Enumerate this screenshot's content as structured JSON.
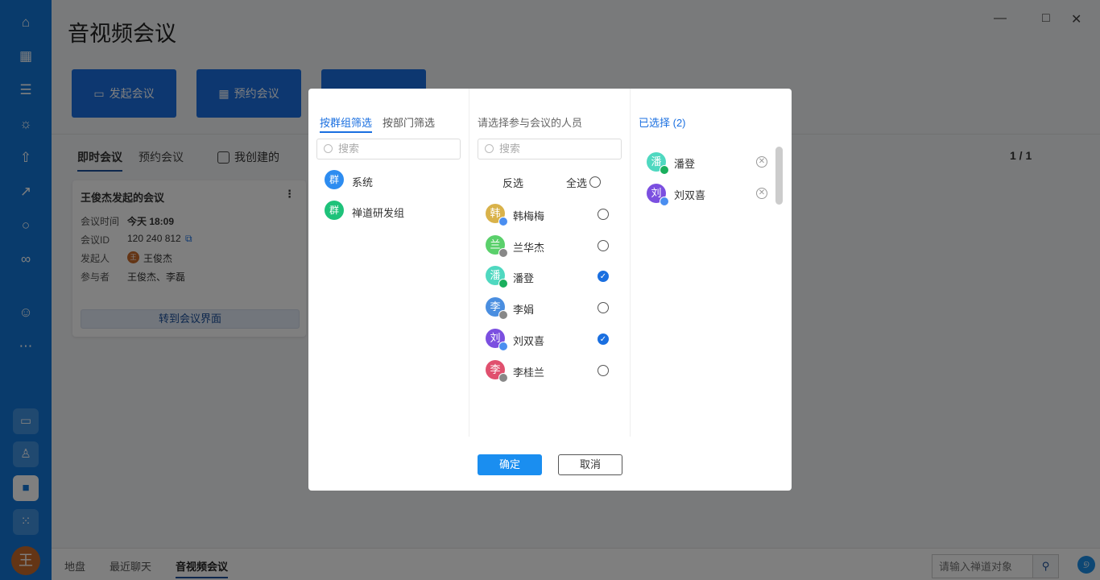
{
  "app": {
    "title": "音视频会议"
  },
  "sidebar": {
    "user_avatar": "王"
  },
  "actions": [
    {
      "label": "发起会议"
    },
    {
      "label": "预约会议"
    }
  ],
  "tabs": {
    "instant": "即时会议",
    "scheduled": "预约会议",
    "mine": "我创建的"
  },
  "pagination": {
    "text": "1 / 1"
  },
  "card": {
    "title": "王俊杰发起的会议",
    "time_label": "会议时间",
    "time": "今天 18:09",
    "id_label": "会议ID",
    "id": "120 240 812",
    "host_label": "发起人",
    "host_avatar": "王",
    "host": "王俊杰",
    "participants_label": "参与者",
    "participants": "王俊杰、李磊",
    "join": "转到会议界面"
  },
  "bottom": {
    "tabs": [
      "地盘",
      "最近聊天",
      "音视频会议"
    ],
    "search_placeholder": "请输入禅道对象"
  },
  "dialog": {
    "filter_tabs": [
      "按群组筛选",
      "按部门筛选"
    ],
    "search_placeholder": "搜索",
    "groups": [
      {
        "avatar": "群",
        "name": "系统",
        "color": "#2d8cf0"
      },
      {
        "avatar": "群",
        "name": "禅道研发组",
        "color": "#1ec27a"
      }
    ],
    "people_title": "请选择参与会议的人员",
    "invert": "反选",
    "select_all": "全选",
    "people": [
      {
        "avatar": "韩",
        "name": "韩梅梅",
        "color": "#d9b24a",
        "status": "#4a8ef0",
        "checked": false
      },
      {
        "avatar": "兰",
        "name": "兰华杰",
        "color": "#5ad06b",
        "status": "#888",
        "checked": false
      },
      {
        "avatar": "潘",
        "name": "潘登",
        "color": "#4fd8c0",
        "status": "#1aaf5d",
        "checked": true
      },
      {
        "avatar": "李",
        "name": "李娟",
        "color": "#4a8ee0",
        "status": "#888",
        "checked": false
      },
      {
        "avatar": "刘",
        "name": "刘双喜",
        "color": "#7b4fe0",
        "status": "#4a8ef0",
        "checked": true
      },
      {
        "avatar": "李",
        "name": "李桂兰",
        "color": "#e0506e",
        "status": "#888",
        "checked": false
      }
    ],
    "selected_title": "已选择 (2)",
    "selected": [
      {
        "avatar": "潘",
        "name": "潘登",
        "color": "#4fd8c0",
        "status": "#1aaf5d"
      },
      {
        "avatar": "刘",
        "name": "刘双喜",
        "color": "#7b4fe0",
        "status": "#4a8ef0"
      }
    ],
    "confirm": "确定",
    "cancel": "取消"
  }
}
